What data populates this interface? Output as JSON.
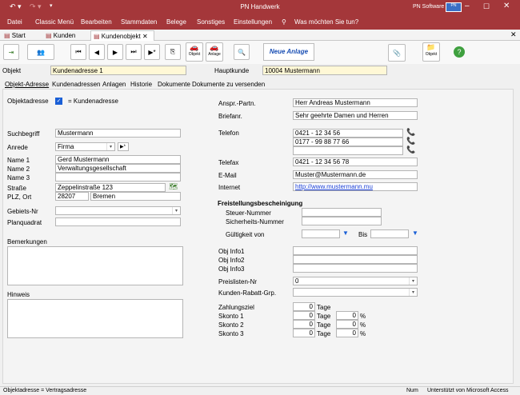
{
  "app": {
    "title": "PN Handwerk",
    "brand": "PN Software",
    "brand_color": "#a4373a"
  },
  "menu": {
    "items": [
      "Datei",
      "Classic Menü",
      "Bearbeiten",
      "Stammdaten",
      "Belege",
      "Sonstiges",
      "Einstellungen"
    ],
    "search": "Was möchten Sie tun?"
  },
  "tabs": [
    {
      "label": "Start"
    },
    {
      "label": "Kunden"
    },
    {
      "label": "Kundenobjekt"
    }
  ],
  "toolbar": {
    "neue_anlage": "Neue Anlage",
    "objekt": "Objekt",
    "anlage": "Anlage",
    "objekt2": "Objekt"
  },
  "header": {
    "objekt_label": "Objekt",
    "objekt_value": "Kundenadresse 1",
    "hauptkunde_label": "Hauptkunde",
    "hauptkunde_value": "10004 Mustermann"
  },
  "subtabs": [
    "Objekt-Adresse",
    "Kundenadressen",
    "Anlagen",
    "Historie",
    "Dokumente",
    "Dokumente zu versenden"
  ],
  "left": {
    "objektadresse_label": "Objektadresse",
    "kundenadresse_label": "= Kundenadresse",
    "suchbegriff_label": "Suchbegriff",
    "suchbegriff": "Mustermann",
    "anrede_label": "Anrede",
    "anrede": "Firma",
    "name1_label": "Name 1",
    "name1": "Gerd Mustermann",
    "name2_label": "Name 2",
    "name2": "Verwaltungsgesellschaft",
    "name3_label": "Name 3",
    "name3": "",
    "strasse_label": "Straße",
    "strasse": "Zeppelinstraße 123",
    "plz_label": "PLZ, Ort",
    "plz": "28207",
    "ort": "Bremen",
    "gebiet_label": "Gebiets-Nr",
    "planquadrat_label": "Planquadrat",
    "bemerkungen_label": "Bemerkungen",
    "hinweis_label": "Hinweis"
  },
  "right": {
    "ansprech_label": "Anspr.-Partn.",
    "ansprech": "Herr Andreas Mustermann",
    "briefanrede_label": "Briefanr.",
    "briefanrede": "Sehr geehrte Damen und Herren",
    "telefon_label": "Telefon",
    "telefon": [
      "0421 - 12 34 56",
      "0177 - 99 88 77 66",
      ""
    ],
    "telefax_label": "Telefax",
    "telefax": "0421 - 12 34 56 78",
    "email_label": "E-Mail",
    "email": "Muster@Mustermann.de",
    "internet_label": "Internet",
    "internet": "http://www.mustermann.mu",
    "freistellung_label": "Freistellungsbescheinigung",
    "steuer_label": "Steuer-Nummer",
    "sicherheit_label": "Sicherheits-Nummer",
    "gueltig_label": "Gültigkeit von",
    "bis_label": "Bis",
    "info1_label": "Obj Info1",
    "info2_label": "Obj Info2",
    "info3_label": "Obj Info3",
    "preisliste_label": "Preislisten-Nr",
    "preisliste": "0",
    "rabatt_label": "Kunden-Rabatt-Grp.",
    "zahlungsziel_label": "Zahlungsziel",
    "zahlungsziel": "0",
    "tage": "Tage",
    "skonto1_label": "Skonto 1",
    "skonto2_label": "Skonto 2",
    "skonto3_label": "Skonto 3",
    "skonto_val": "0",
    "percent": "%"
  },
  "status": {
    "left": "Objektadresse = Vertragsadresse",
    "num": "Num",
    "right": "Unterstützt von Microsoft Access"
  }
}
